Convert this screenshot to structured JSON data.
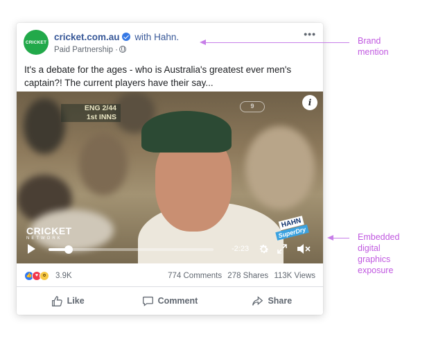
{
  "post": {
    "avatar_text": "CRICKET",
    "page_name": "cricket.com.au",
    "with_label": "with Hahn.",
    "subtitle": "Paid Partnership ·",
    "more_label": "•••",
    "caption": "It's a debate for the ages - who is Australia's greatest ever men's captain?! The current players have their say..."
  },
  "video": {
    "score_line1": "ENG 2/44",
    "score_line2": "1st INNS",
    "channel_logo": "9",
    "info_label": "i",
    "watermark": "CRICKET",
    "watermark_sub": "NETWORK",
    "sponsor_top": "HAHN",
    "sponsor_bottom": "SuperDry",
    "time_remaining": "-2:23",
    "progress_fraction": 0.12
  },
  "stats": {
    "reaction_count": "3.9K",
    "comments": "774 Comments",
    "shares": "278 Shares",
    "views": "113K Views"
  },
  "actions": {
    "like": "Like",
    "comment": "Comment",
    "share": "Share"
  },
  "annotations": {
    "brand_mention": [
      "Brand",
      "mention"
    ],
    "embedded": [
      "Embedded",
      "digital",
      "graphics",
      "exposure"
    ]
  },
  "colors": {
    "brand_link": "#385898",
    "annotation": "#c058e0",
    "avatar_green": "#22a94a"
  }
}
